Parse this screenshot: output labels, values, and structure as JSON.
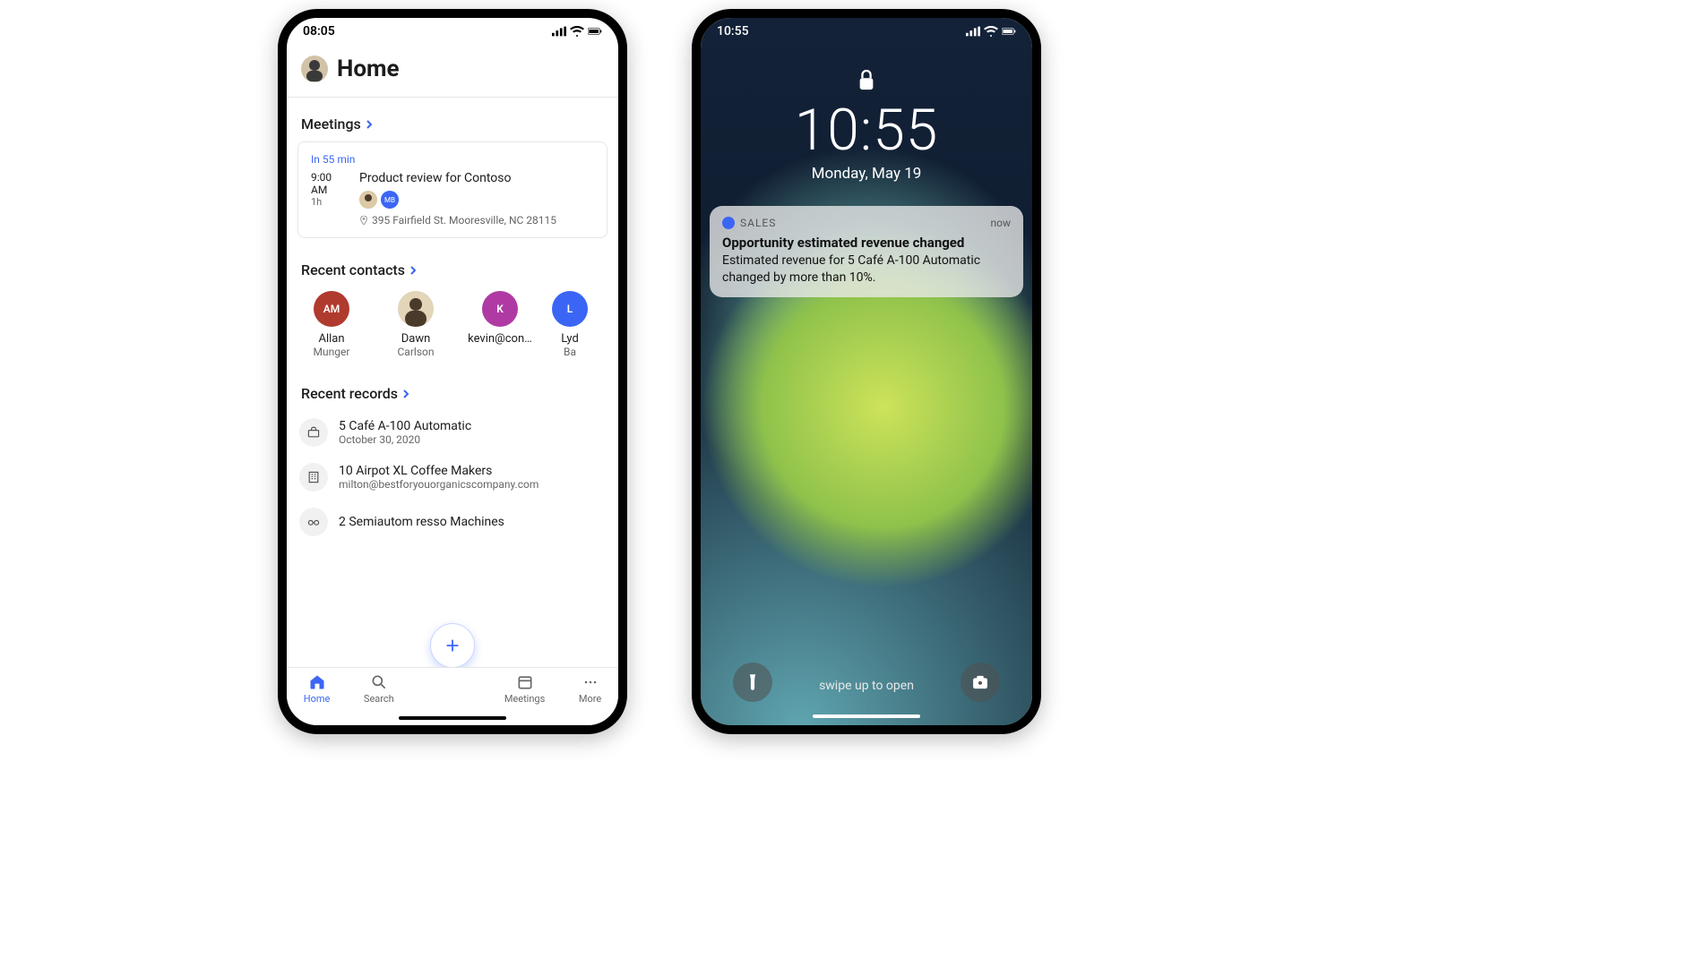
{
  "left": {
    "status_time": "08:05",
    "header": {
      "title": "Home"
    },
    "sections": {
      "meetings_label": "Meetings",
      "contacts_label": "Recent contacts",
      "records_label": "Recent records"
    },
    "meeting": {
      "until": "In 55 min",
      "time": "9:00 AM",
      "duration": "1h",
      "title": "Product review for Contoso",
      "attendee_initials": "MB",
      "location": "395 Fairfield St. Mooresville, NC 28115"
    },
    "contacts": [
      {
        "initials": "AM",
        "color": "#b03a2e",
        "line1": "Allan",
        "line2": "Munger"
      },
      {
        "initials": "",
        "color": "#c9c9c9",
        "line1": "Dawn",
        "line2": "Carlson",
        "photo": true
      },
      {
        "initials": "K",
        "color": "#b03aa3",
        "line1": "kevin@con…",
        "line2": ""
      },
      {
        "initials": "L",
        "color": "#3b66f5",
        "line1": "Lyd",
        "line2": "Ba"
      }
    ],
    "records": [
      {
        "icon": "briefcase",
        "title": "5 Café A-100 Automatic",
        "sub": "October 30, 2020"
      },
      {
        "icon": "building",
        "title": "10 Airpot XL Coffee Makers",
        "sub": "milton@bestforyouorganicscompany.com"
      },
      {
        "icon": "glasses",
        "title": "2 Semiautom           resso Machines",
        "sub": ""
      }
    ],
    "tabs": [
      {
        "icon": "home",
        "label": "Home",
        "active": true
      },
      {
        "icon": "search",
        "label": "Search",
        "active": false
      },
      {
        "icon": "meetings",
        "label": "Meetings",
        "active": false
      },
      {
        "icon": "more",
        "label": "More",
        "active": false
      }
    ]
  },
  "right": {
    "status_time": "10:55",
    "clock": "10:55",
    "date": "Monday, May 19",
    "notification": {
      "app": "SALES",
      "when": "now",
      "title": "Opportunity estimated revenue changed",
      "body": "Estimated revenue for 5 Café A-100 Automatic changed by more than 10%."
    },
    "swipe": "swipe up to open"
  }
}
